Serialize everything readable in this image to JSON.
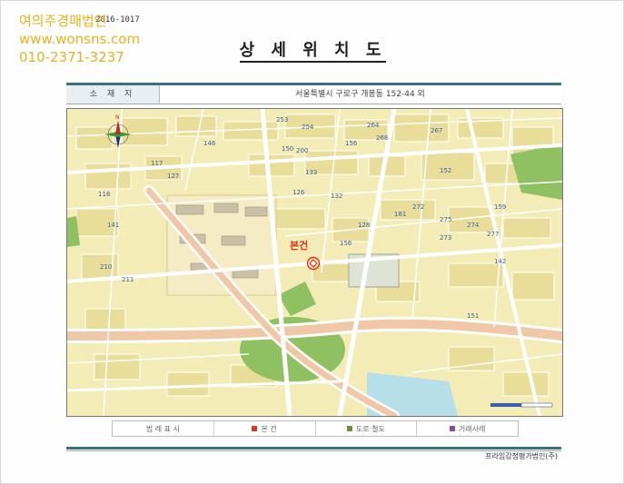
{
  "watermark": {
    "name": "여의주경매법인",
    "website": "www.wonsns.com",
    "phone": "010-2371-3237"
  },
  "doc_code": "2016-1017",
  "title": "상 세 위 치 도",
  "location": {
    "label": "소 재 지",
    "value": "서울특별시 구로구 개봉동 152-44 외"
  },
  "map": {
    "subject_label": "본건",
    "compass_n": "N",
    "lot_numbers": [
      "253",
      "254",
      "267",
      "264",
      "146",
      "268",
      "152",
      "150",
      "156",
      "133",
      "117",
      "118",
      "132",
      "272",
      "275",
      "274",
      "273",
      "277",
      "200",
      "141",
      "142",
      "181",
      "126",
      "210",
      "211",
      "128",
      "156",
      "159",
      "127",
      "151"
    ]
  },
  "legend": [
    {
      "label": "범 례 표 시",
      "color": ""
    },
    {
      "label": "본 건",
      "color": "#d8342a"
    },
    {
      "label": "도로·철도",
      "color": "#6f8b3f"
    },
    {
      "label": "거래사례",
      "color": "#8a4a9a"
    }
  ],
  "company": "프라임감정평가법인(주)",
  "colors": {
    "watermark": "#e8b31c",
    "accent_bar": "#3a6f86",
    "map_base": "#f3ecb6",
    "road": "#ffffff",
    "park": "#8fc062",
    "water": "#b6dfea",
    "subject": "#e23018"
  }
}
